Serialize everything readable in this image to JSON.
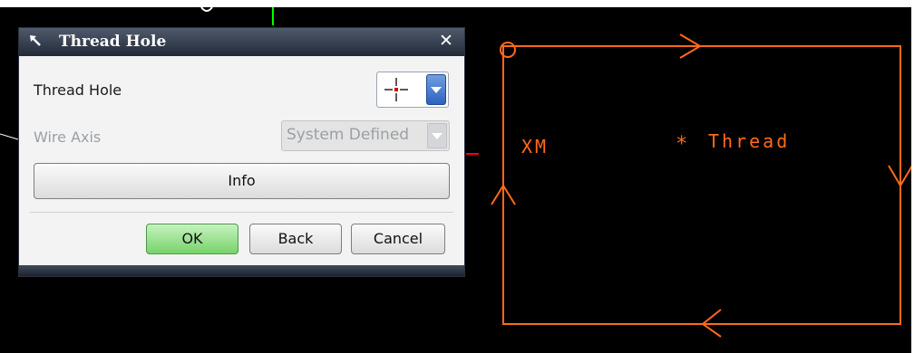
{
  "dialog": {
    "title": "Thread Hole",
    "close_glyph": "✕",
    "rows": {
      "thread_hole_label": "Thread Hole",
      "wire_axis_label": "Wire Axis",
      "wire_axis_value": "System Defined"
    },
    "buttons": {
      "info": "Info",
      "ok": "OK",
      "back": "Back",
      "cancel": "Cancel"
    },
    "icons": {
      "pin": "pin-icon",
      "close": "close-icon",
      "thread_point": "thread-point-icon",
      "dropdown": "chevron-down-icon"
    }
  },
  "canvas": {
    "labels": {
      "xm": "XM",
      "thread": "Thread",
      "thread_marker": "*"
    },
    "colors": {
      "background": "#000000",
      "wire": "#ff6a1a",
      "axis_green": "#00ff00",
      "axis_red": "#ff0000",
      "ok_button": "#78d36c",
      "dropdown_blue": "#2d63c0"
    }
  }
}
